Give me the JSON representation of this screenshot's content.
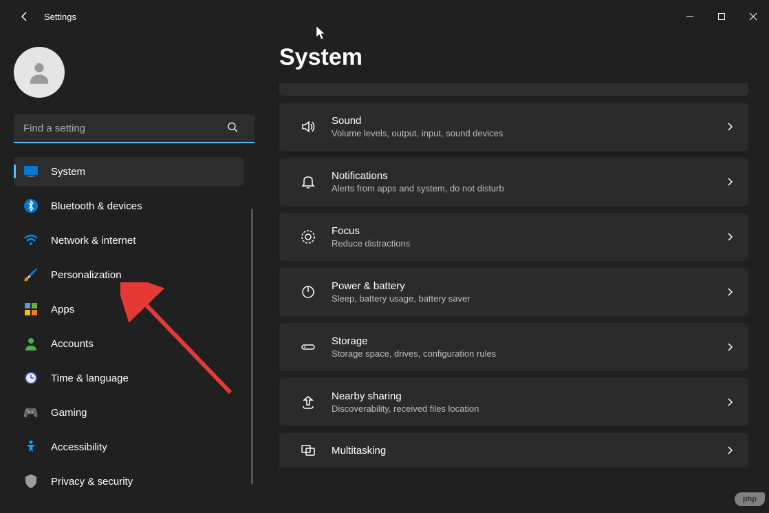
{
  "app_title": "Settings",
  "search": {
    "placeholder": "Find a setting"
  },
  "sidebar": {
    "items": [
      {
        "label": "System",
        "active": true
      },
      {
        "label": "Bluetooth & devices"
      },
      {
        "label": "Network & internet"
      },
      {
        "label": "Personalization"
      },
      {
        "label": "Apps"
      },
      {
        "label": "Accounts"
      },
      {
        "label": "Time & language"
      },
      {
        "label": "Gaming"
      },
      {
        "label": "Accessibility"
      },
      {
        "label": "Privacy & security"
      }
    ]
  },
  "page": {
    "title": "System",
    "cards": [
      {
        "title": "Sound",
        "sub": "Volume levels, output, input, sound devices"
      },
      {
        "title": "Notifications",
        "sub": "Alerts from apps and system, do not disturb"
      },
      {
        "title": "Focus",
        "sub": "Reduce distractions"
      },
      {
        "title": "Power & battery",
        "sub": "Sleep, battery usage, battery saver"
      },
      {
        "title": "Storage",
        "sub": "Storage space, drives, configuration rules"
      },
      {
        "title": "Nearby sharing",
        "sub": "Discoverability, received files location"
      },
      {
        "title": "Multitasking",
        "sub": ""
      }
    ]
  },
  "watermark": "php"
}
